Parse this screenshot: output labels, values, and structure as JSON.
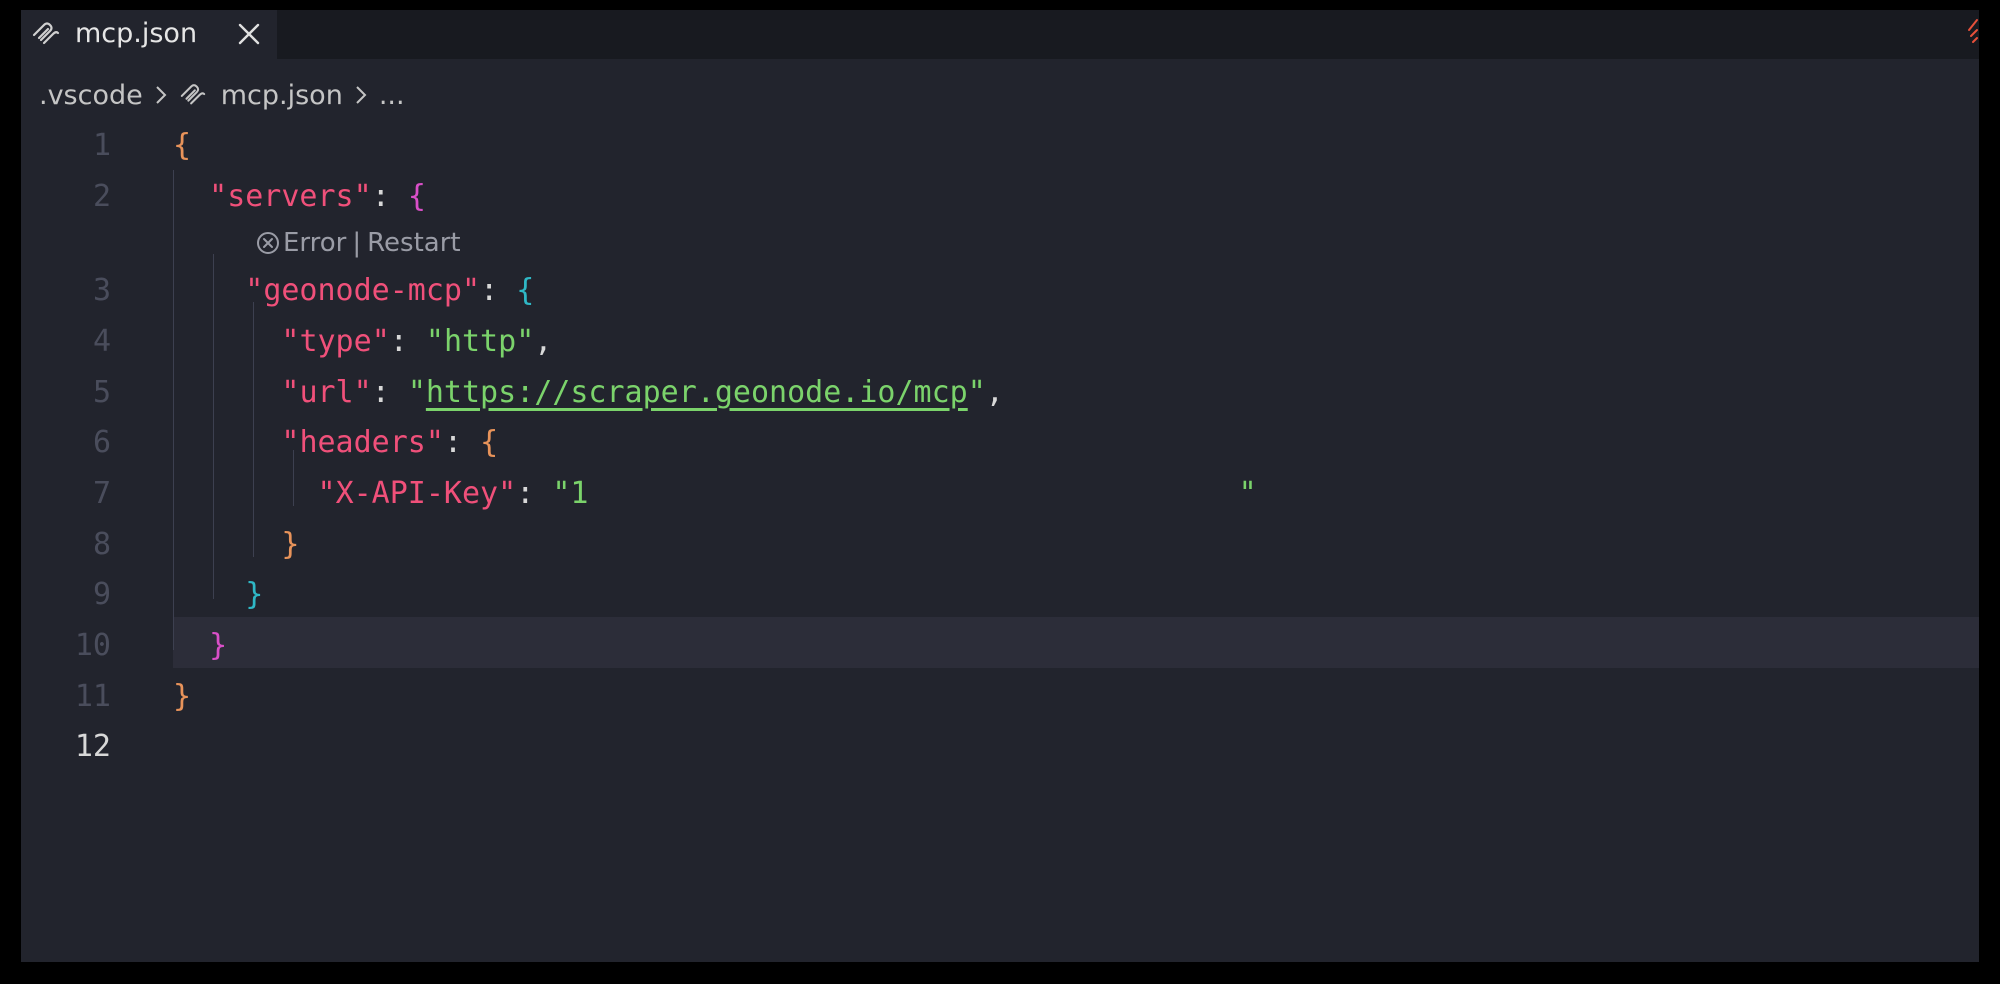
{
  "tab": {
    "filename": "mcp.json"
  },
  "breadcrumb": {
    "folder": ".vscode",
    "file": "mcp.json",
    "more": "..."
  },
  "codelens": {
    "error_label": "Error",
    "divider": "|",
    "restart_label": "Restart"
  },
  "code": {
    "line_numbers": [
      "1",
      "2",
      "3",
      "4",
      "5",
      "6",
      "7",
      "8",
      "9",
      "10",
      "11",
      "12"
    ],
    "servers_key": "servers",
    "server_name_key": "geonode-mcp",
    "type_key": "type",
    "type_value": "http",
    "url_key": "url",
    "url_value": "https://scraper.geonode.io/mcp",
    "headers_key": "headers",
    "api_key_key": "X-API-Key",
    "api_key_value_visible": "1"
  },
  "colors": {
    "editor_bg": "#22242d",
    "tabbar_bg": "#181a20",
    "key": "#f0507a",
    "string": "#7bd36b",
    "bracket_level1": "#e8935a",
    "bracket_level2": "#d94fc8",
    "bracket_level3": "#2fb8c6"
  }
}
